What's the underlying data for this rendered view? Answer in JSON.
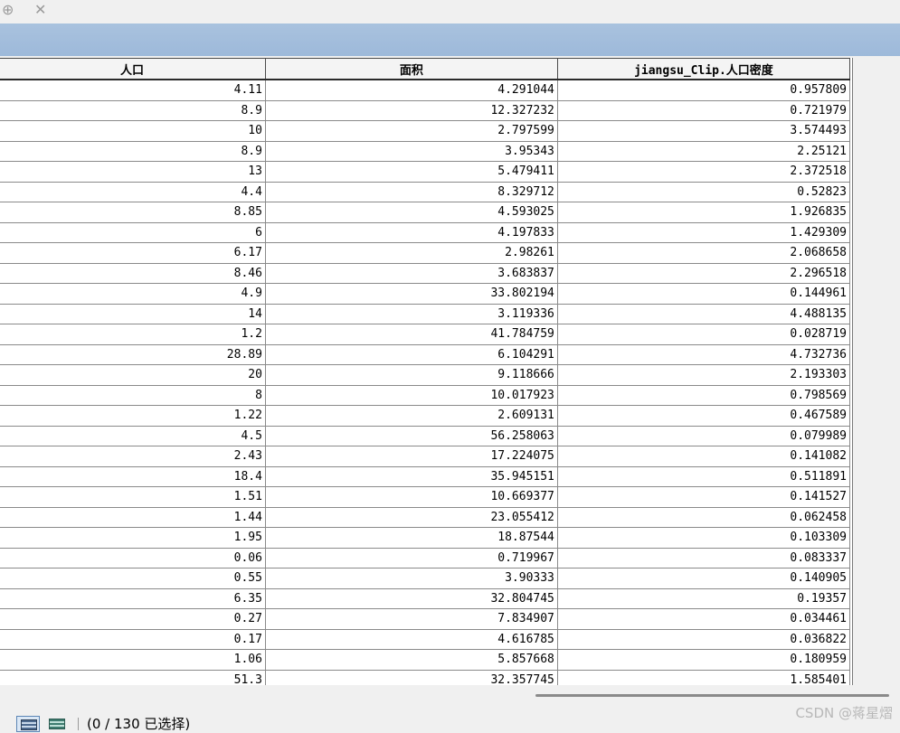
{
  "toolbar": {
    "icons": [
      "zoom-to-selection-icon",
      "close-icon"
    ],
    "zoom_glyph": "⊕",
    "close_glyph": "✕"
  },
  "table": {
    "columns": [
      "人口",
      "面积",
      "jiangsu_Clip.人口密度"
    ],
    "rows": [
      [
        "4.11",
        "4.291044",
        "0.957809"
      ],
      [
        "8.9",
        "12.327232",
        "0.721979"
      ],
      [
        "10",
        "2.797599",
        "3.574493"
      ],
      [
        "8.9",
        "3.95343",
        "2.25121"
      ],
      [
        "13",
        "5.479411",
        "2.372518"
      ],
      [
        "4.4",
        "8.329712",
        "0.52823"
      ],
      [
        "8.85",
        "4.593025",
        "1.926835"
      ],
      [
        "6",
        "4.197833",
        "1.429309"
      ],
      [
        "6.17",
        "2.98261",
        "2.068658"
      ],
      [
        "8.46",
        "3.683837",
        "2.296518"
      ],
      [
        "4.9",
        "33.802194",
        "0.144961"
      ],
      [
        "14",
        "3.119336",
        "4.488135"
      ],
      [
        "1.2",
        "41.784759",
        "0.028719"
      ],
      [
        "28.89",
        "6.104291",
        "4.732736"
      ],
      [
        "20",
        "9.118666",
        "2.193303"
      ],
      [
        "8",
        "10.017923",
        "0.798569"
      ],
      [
        "1.22",
        "2.609131",
        "0.467589"
      ],
      [
        "4.5",
        "56.258063",
        "0.079989"
      ],
      [
        "2.43",
        "17.224075",
        "0.141082"
      ],
      [
        "18.4",
        "35.945151",
        "0.511891"
      ],
      [
        "1.51",
        "10.669377",
        "0.141527"
      ],
      [
        "1.44",
        "23.055412",
        "0.062458"
      ],
      [
        "1.95",
        "18.87544",
        "0.103309"
      ],
      [
        "0.06",
        "0.719967",
        "0.083337"
      ],
      [
        "0.55",
        "3.90333",
        "0.140905"
      ],
      [
        "6.35",
        "32.804745",
        "0.19357"
      ],
      [
        "0.27",
        "7.834907",
        "0.034461"
      ],
      [
        "0.17",
        "4.616785",
        "0.036822"
      ],
      [
        "1.06",
        "5.857668",
        "0.180959"
      ],
      [
        "51.3",
        "32.357745",
        "1.585401"
      ]
    ]
  },
  "status": {
    "selection_text": "(0 / 130 已选择)",
    "view_buttons": [
      "show-all-records-icon",
      "show-selected-records-icon"
    ]
  },
  "watermark": "CSDN @蒋星熠",
  "colors": {
    "titlebar": "#a9c2de",
    "background": "#f0f0f0",
    "grid_line": "#8a8a8a"
  }
}
